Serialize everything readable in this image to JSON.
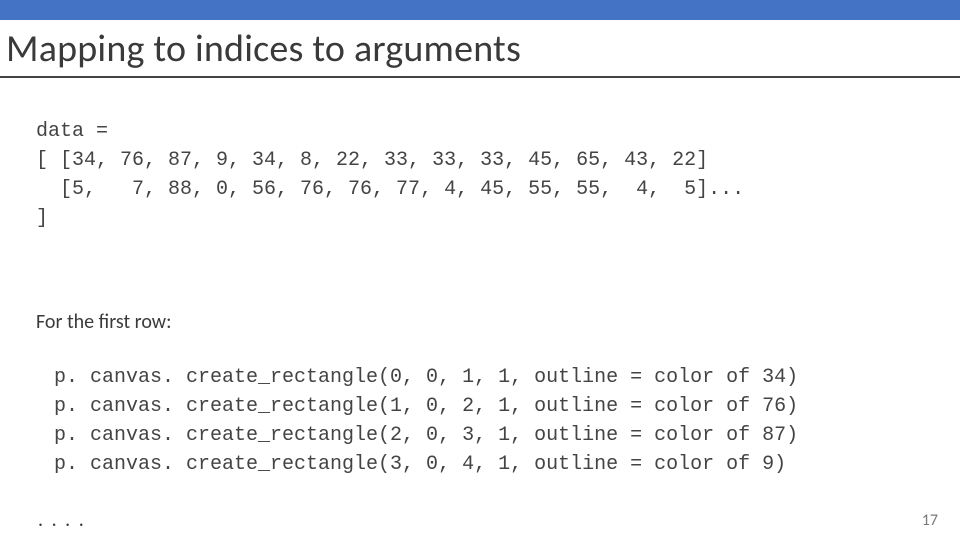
{
  "title": "Mapping to indices to arguments",
  "code": {
    "data_decl": "data =",
    "row1": "[ [34, 76, 87, 9, 34, 8, 22, 33, 33, 33, 45, 65, 43, 22]",
    "row2": "  [5,   7, 88, 0, 56, 76, 76, 77, 4, 45, 55, 55,  4,  5]...",
    "row3": "]"
  },
  "body_intro": "For the first row:",
  "calls": {
    "l1": "p. canvas. create_rectangle(0, 0, 1, 1, outline = color of 34)",
    "l2": "p. canvas. create_rectangle(1, 0, 2, 1, outline = color of 76)",
    "l3": "p. canvas. create_rectangle(2, 0, 3, 1, outline = color of 87)",
    "l4": "p. canvas. create_rectangle(3, 0, 4, 1, outline = color of 9)"
  },
  "ellipsis": ". . . .",
  "slide_number": "17"
}
